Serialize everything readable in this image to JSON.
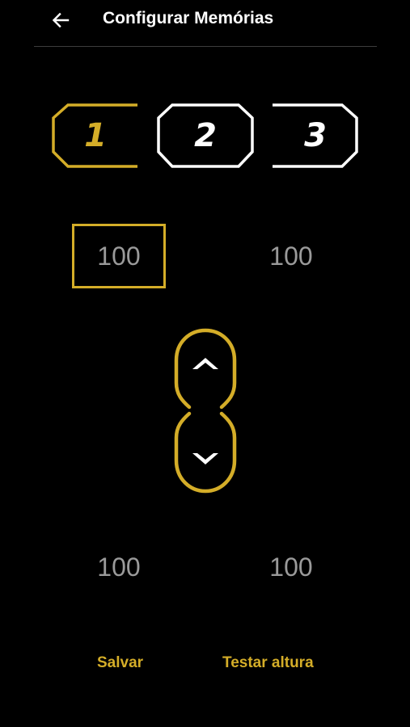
{
  "colors": {
    "background": "#000000",
    "accent": "#d4ad28",
    "text_primary": "#ffffff",
    "value_text": "#9a9a9a",
    "divider": "#3c3c3c"
  },
  "header": {
    "back_icon": "arrow-left-icon",
    "title": "Configurar Memórias"
  },
  "memory_tabs": [
    {
      "label": "1",
      "selected": true
    },
    {
      "label": "2",
      "selected": false
    },
    {
      "label": "3",
      "selected": false
    }
  ],
  "values": {
    "top_left": "100",
    "top_right": "100",
    "bottom_left": "100",
    "bottom_right": "100"
  },
  "height_control": {
    "up_icon": "chevron-up-icon",
    "down_icon": "chevron-down-icon"
  },
  "actions": {
    "save_label": "Salvar",
    "test_label": "Testar altura"
  }
}
